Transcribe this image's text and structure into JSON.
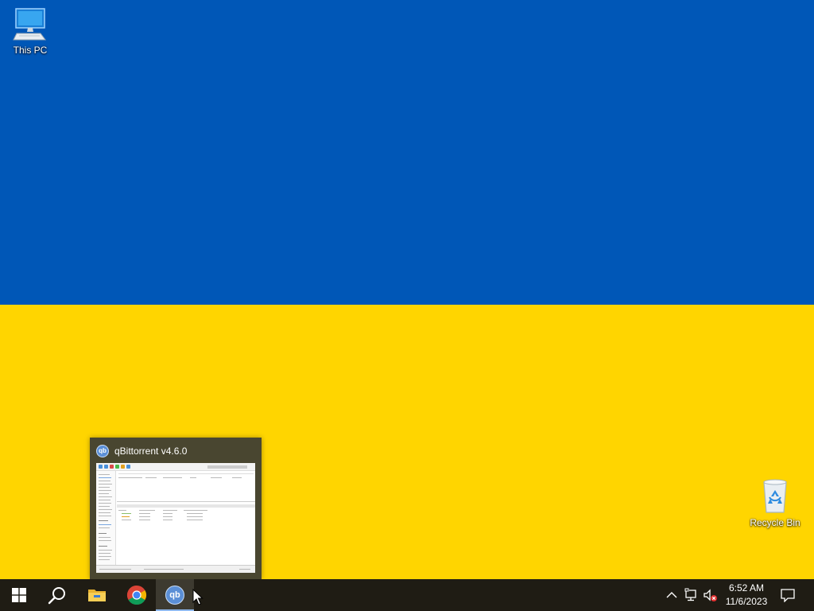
{
  "desktop": {
    "background_colors": {
      "top": "#0057b7",
      "bottom": "#ffd500"
    },
    "icons": [
      {
        "label": "This PC",
        "icon": "computer-icon"
      },
      {
        "label": "Recycle Bin",
        "icon": "recycle-bin-icon"
      }
    ]
  },
  "thumbnail": {
    "title": "qBittorrent v4.6.0",
    "icon": "qbittorrent-icon",
    "logo_text": "qb"
  },
  "taskbar": {
    "buttons": [
      {
        "name": "start",
        "icon": "windows-logo-icon"
      },
      {
        "name": "search",
        "icon": "search-icon"
      },
      {
        "name": "file-explorer",
        "icon": "folder-icon"
      },
      {
        "name": "chrome",
        "icon": "chrome-icon"
      },
      {
        "name": "qbittorrent",
        "icon": "qbittorrent-icon",
        "active": true
      }
    ],
    "tray": {
      "icons": [
        "chevron-up-icon",
        "network-icon",
        "volume-muted-icon"
      ],
      "time": "6:52 AM",
      "date": "11/6/2023"
    },
    "background_color": "#1f1c14",
    "accent_color": "#8fb8ee"
  }
}
